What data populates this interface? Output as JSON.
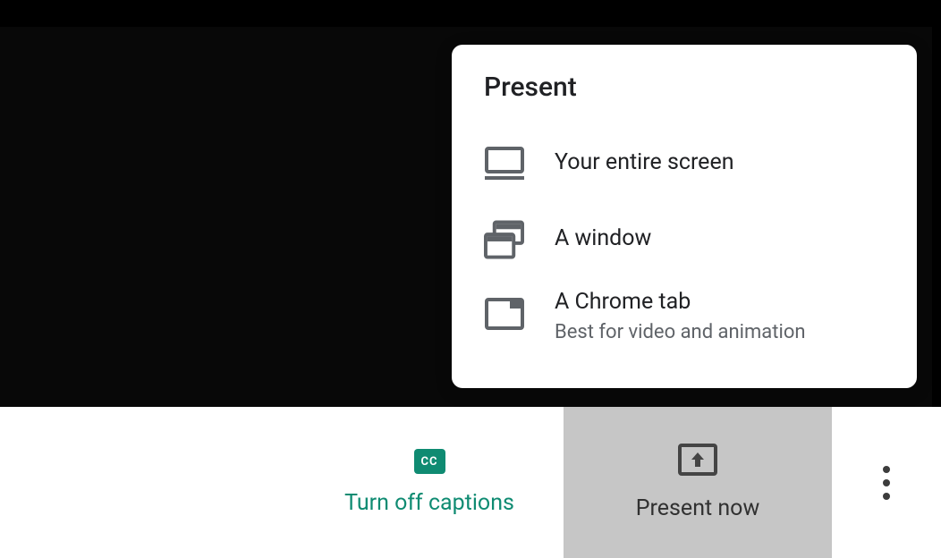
{
  "popup": {
    "title": "Present",
    "options": [
      {
        "label": "Your entire screen",
        "sublabel": null
      },
      {
        "label": "A window",
        "sublabel": null
      },
      {
        "label": "A Chrome tab",
        "sublabel": "Best for video and animation"
      }
    ]
  },
  "toolbar": {
    "captions_label": "Turn off captions",
    "captions_badge": "CC",
    "present_label": "Present now"
  },
  "colors": {
    "teal": "#0f8b72",
    "active_bg": "#c6c6c6",
    "icon_gray": "#5f6368"
  }
}
